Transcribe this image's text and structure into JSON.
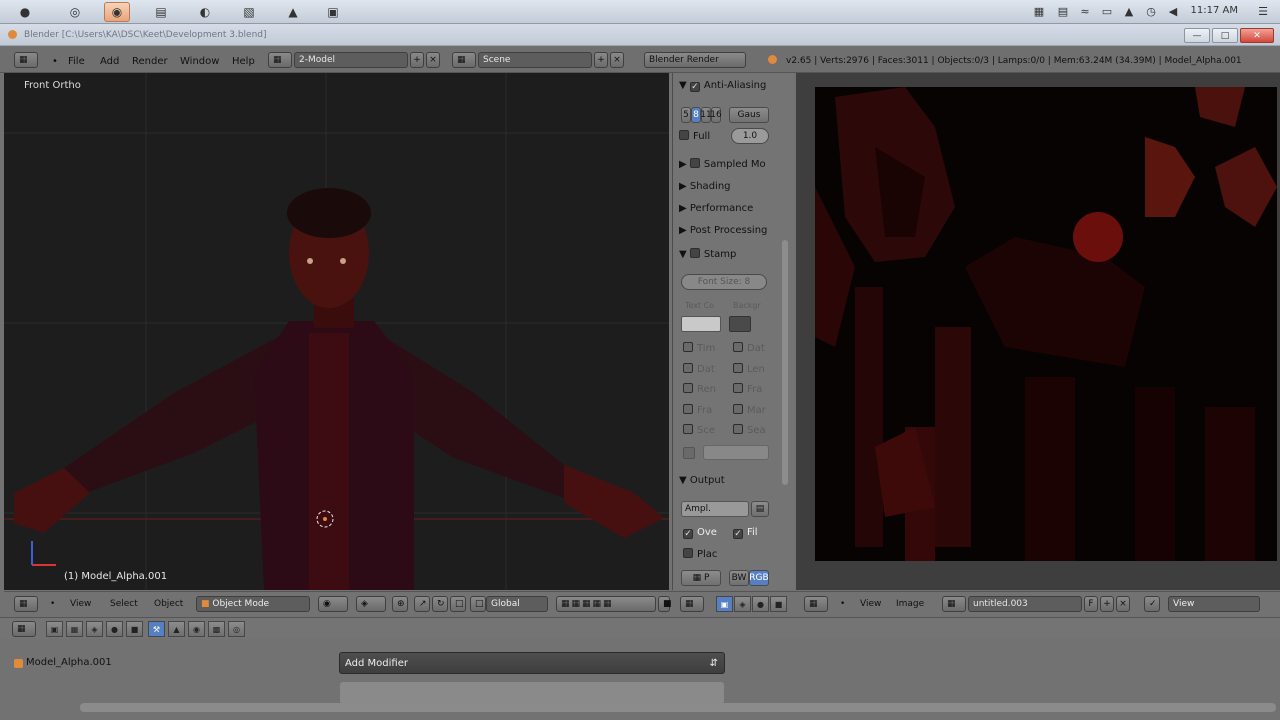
{
  "taskbar": {
    "apps": [
      {
        "name": "apple-icon",
        "glyph": "●"
      },
      {
        "name": "chrome-icon",
        "glyph": "◎"
      },
      {
        "name": "blender-app-icon",
        "glyph": "◉"
      },
      {
        "name": "file-manager-icon",
        "glyph": "▤"
      },
      {
        "name": "globe-icon",
        "glyph": "◐"
      },
      {
        "name": "image-viewer-icon",
        "glyph": "▧"
      },
      {
        "name": "map-icon",
        "glyph": "▲"
      },
      {
        "name": "camera-icon",
        "glyph": "▣"
      }
    ],
    "clock": "11:17 AM"
  },
  "window": {
    "title": "Blender [C:\\Users\\KA\\DSC\\Keet\\Development 3.blend]"
  },
  "header": {
    "menu": [
      "File",
      "Add",
      "Render",
      "Window",
      "Help"
    ],
    "layout": "2-Model",
    "scene": "Scene",
    "engine": "Blender Render",
    "stats": "v2.65 | Verts:2976 | Faces:3011 | Objects:0/3 | Lamps:0/0 | Mem:63.24M (34.39M) | Model_Alpha.001"
  },
  "viewport": {
    "label": "Front Ortho",
    "object_label": "(1) Model_Alpha.001"
  },
  "properties": {
    "anti_aliasing": "Anti-Aliasing",
    "aa_samples": [
      "5",
      "8",
      "11",
      "16"
    ],
    "filter": "Gaus",
    "full": "Full",
    "filter_size": "1.0",
    "sampled_motion": "Sampled Mo",
    "shading": "Shading",
    "performance": "Performance",
    "post_processing": "Post Processing",
    "stamp": "Stamp",
    "font_size": "Font Size: 8",
    "text_color": "Text Co",
    "background": "Backgr",
    "stamp_items": [
      [
        "Tim",
        "Dat"
      ],
      [
        "Dat",
        "Len"
      ],
      [
        "Ren",
        "Fra"
      ],
      [
        "Fra",
        "Mar"
      ],
      [
        "Sce",
        "Sea"
      ]
    ],
    "output": "Output",
    "output_path": "Ampl.",
    "overwrite": "Ove",
    "file_ext": "Fil",
    "placeholders": "Plac",
    "format_bw": "BW",
    "format_rgb": "RGB",
    "format_png": "P"
  },
  "footer_viewport": {
    "view": "View",
    "select": "Select",
    "object": "Object",
    "mode": "Object Mode",
    "orientation": "Global"
  },
  "footer_image": {
    "view": "View",
    "image": "Image",
    "image_name": "untitled.003",
    "view_right": "View"
  },
  "modifiers": {
    "object_name": "Model_Alpha.001",
    "add_modifier": "Add Modifier"
  },
  "colors": {
    "accent": "#5680c2",
    "render_red": "#8a1a12",
    "viewport_bg": "#1d1d1d"
  }
}
